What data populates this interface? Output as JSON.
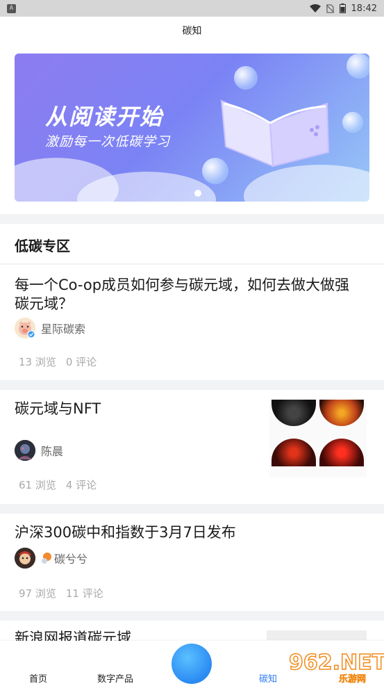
{
  "status_bar": {
    "app_glyph": "A",
    "time": "18:42"
  },
  "title": "碳知",
  "banner": {
    "headline": "从阅读开始",
    "subtitle": "激励每一次低碳学习"
  },
  "section": {
    "title": "低碳专区"
  },
  "posts": [
    {
      "title": "每一个Co-op成员如何参与碳元域，如何去做大做强碳元域？",
      "author": "星际碳索",
      "views": "13 浏览",
      "comments": "0 评论"
    },
    {
      "title": "碳元域与NFT",
      "author": "陈晨",
      "views": "61 浏览",
      "comments": "4 评论"
    },
    {
      "title": "沪深300碳中和指数于3月7日发布",
      "author": "碳兮兮",
      "views": "97 浏览",
      "comments": "11 评论"
    },
    {
      "title": "新浪网报道碳元域"
    }
  ],
  "tabs": {
    "home": "首页",
    "digital": "数字产品",
    "carbon": "碳知"
  },
  "watermark": {
    "big": "962.NET",
    "small": "乐游网"
  }
}
